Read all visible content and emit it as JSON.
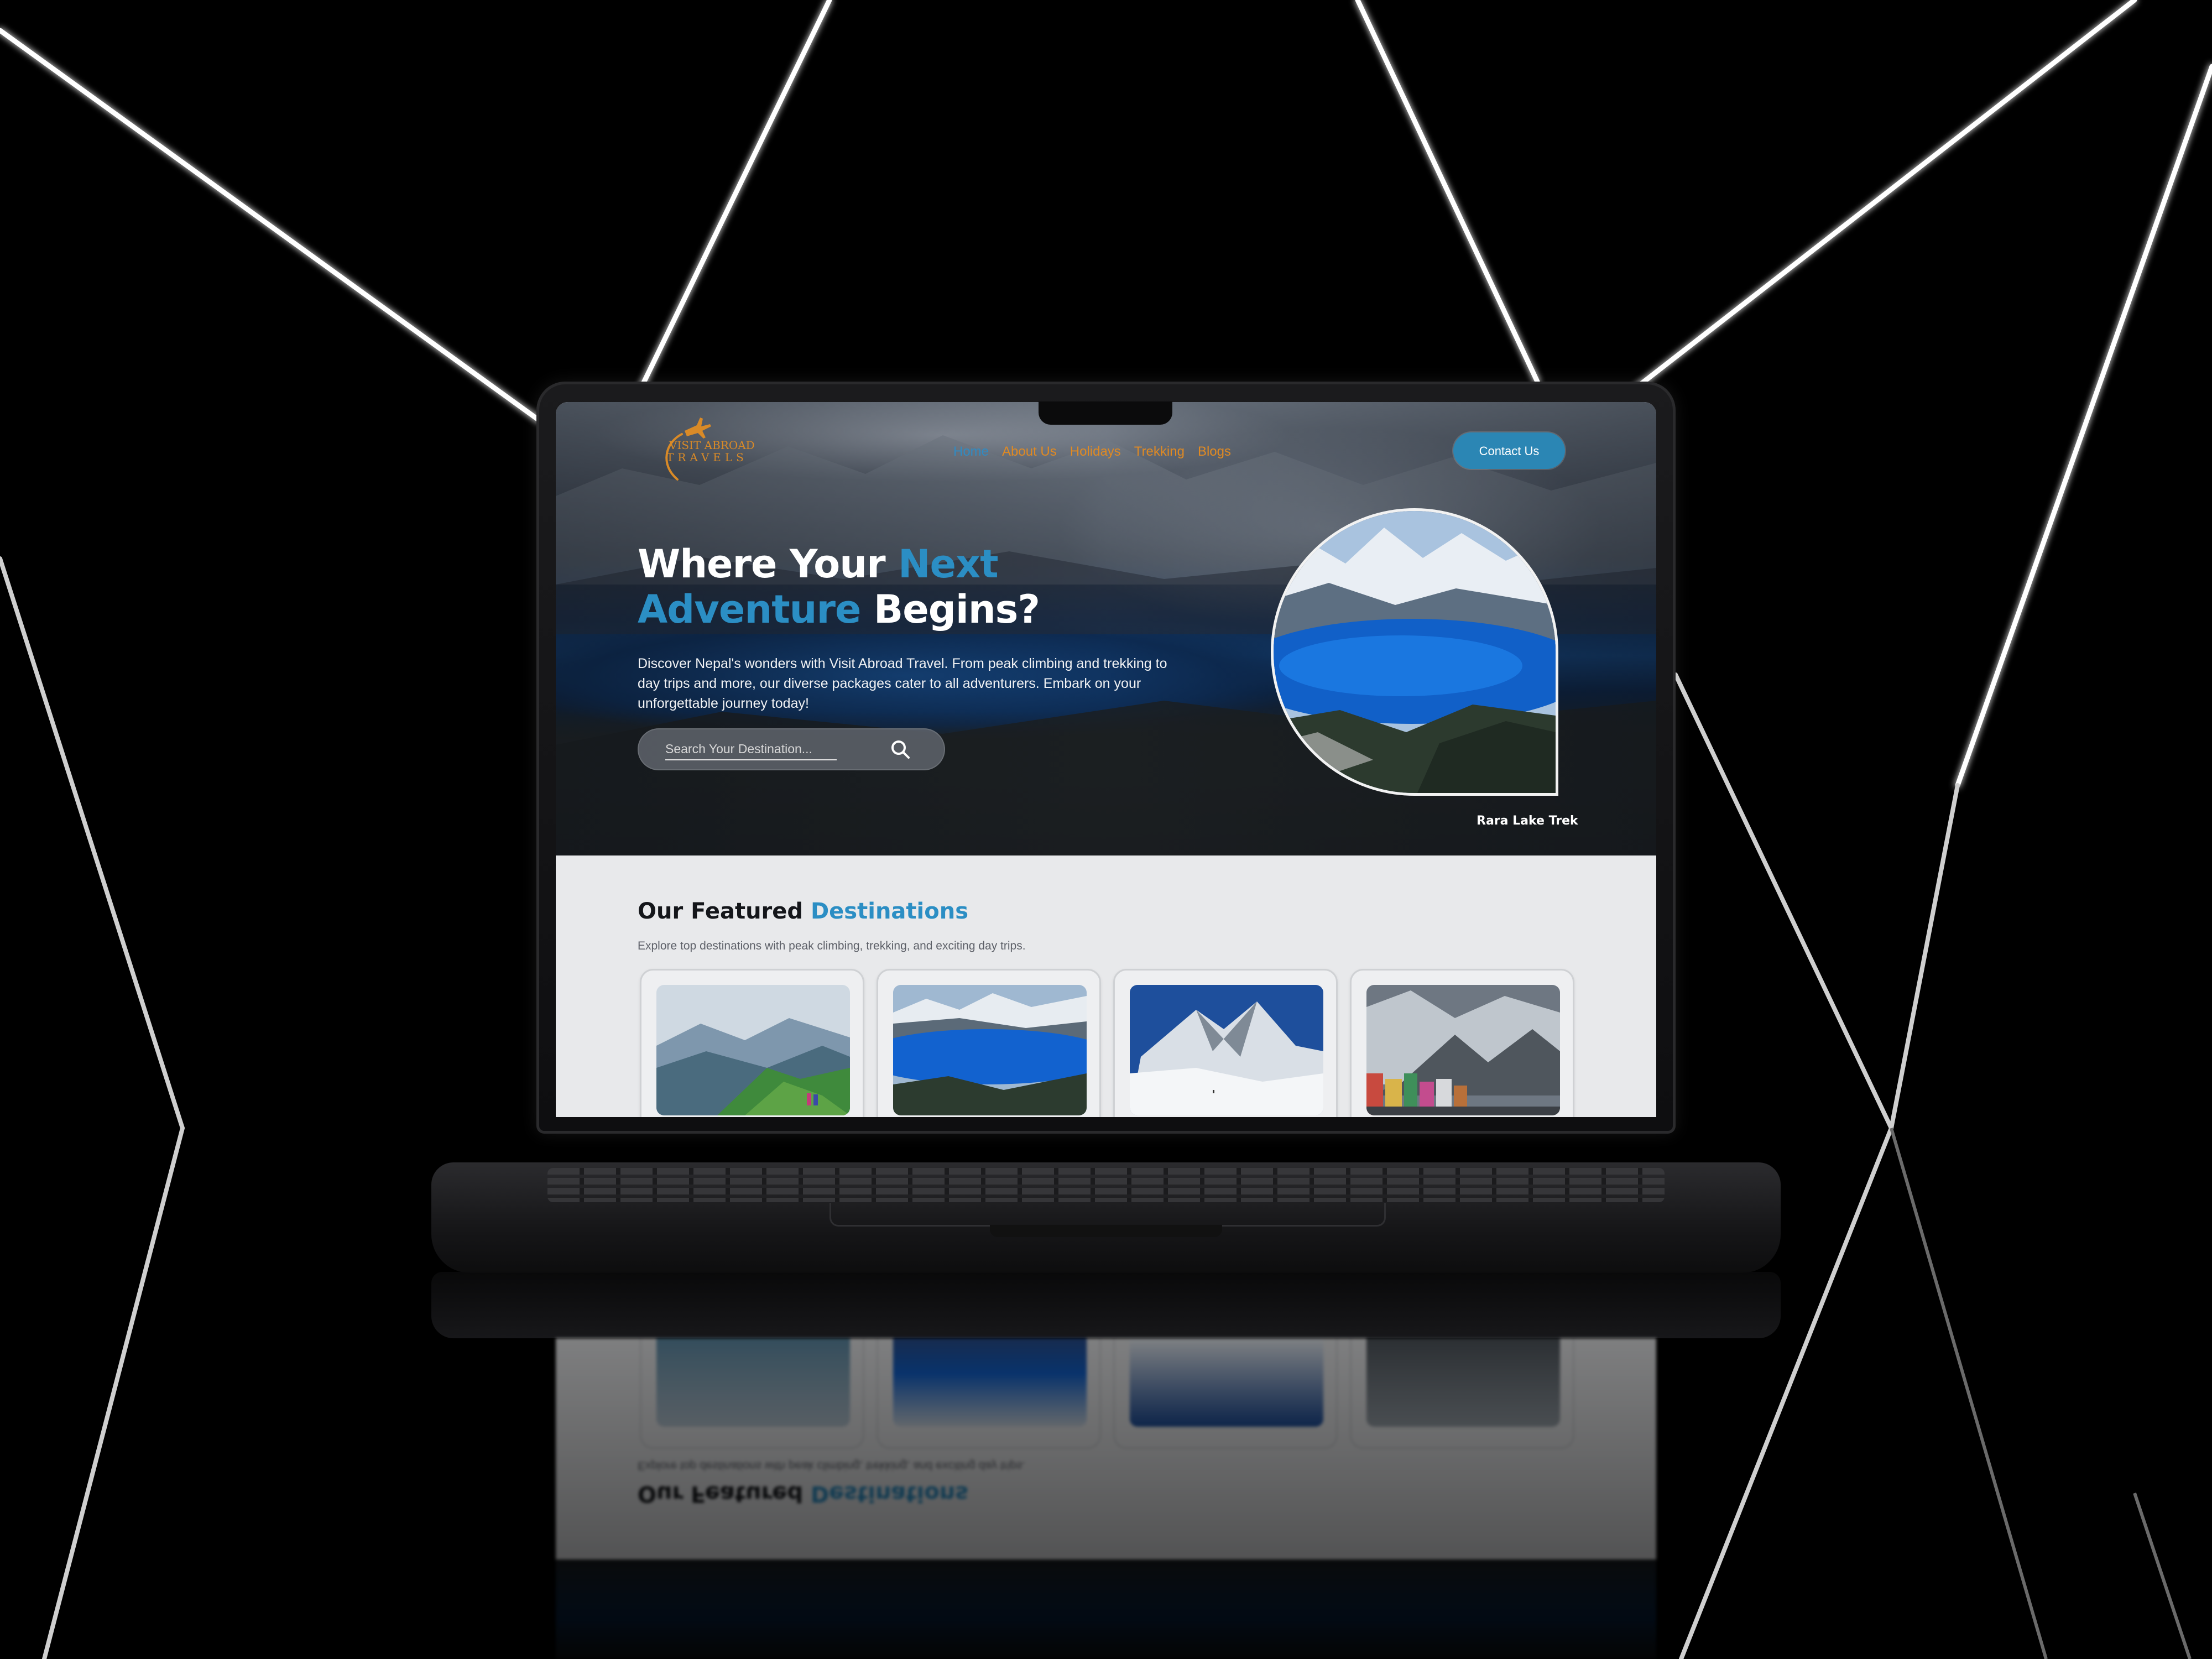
{
  "site": {
    "logo": {
      "line1": "VISIT ABROAD",
      "line2": "TRAVELS",
      "icon": "airplane-icon",
      "color": "#d98a27"
    },
    "nav": [
      {
        "label": "Home",
        "active": true
      },
      {
        "label": "About Us",
        "active": false
      },
      {
        "label": "Holidays",
        "active": false
      },
      {
        "label": "Trekking",
        "active": false
      },
      {
        "label": "Blogs",
        "active": false
      }
    ],
    "contact_button": "Contact Us",
    "hero": {
      "headline_part1": "Where Your ",
      "headline_accent1": "Next",
      "headline_accent2": "Adventure",
      "headline_part2": " Begins?",
      "description": "Discover Nepal's wonders with Visit Abroad Travel. From peak climbing and trekking to day trips and more, our diverse packages cater to all adventurers. Embark on your unforgettable journey today!",
      "search_placeholder": "Search Your Destination...",
      "search_icon": "search-icon",
      "photo_caption": "Rara Lake Trek"
    },
    "featured": {
      "title": "Our Featured ",
      "title_accent": "Destinations",
      "subtitle": "Explore top destinations with peak climbing, trekking, and exciting day trips."
    },
    "colors": {
      "accent": "#2b8ec4",
      "nav_orange": "#e08a23",
      "button": "#2b86b4",
      "section_bg": "#e8e9eb"
    }
  }
}
